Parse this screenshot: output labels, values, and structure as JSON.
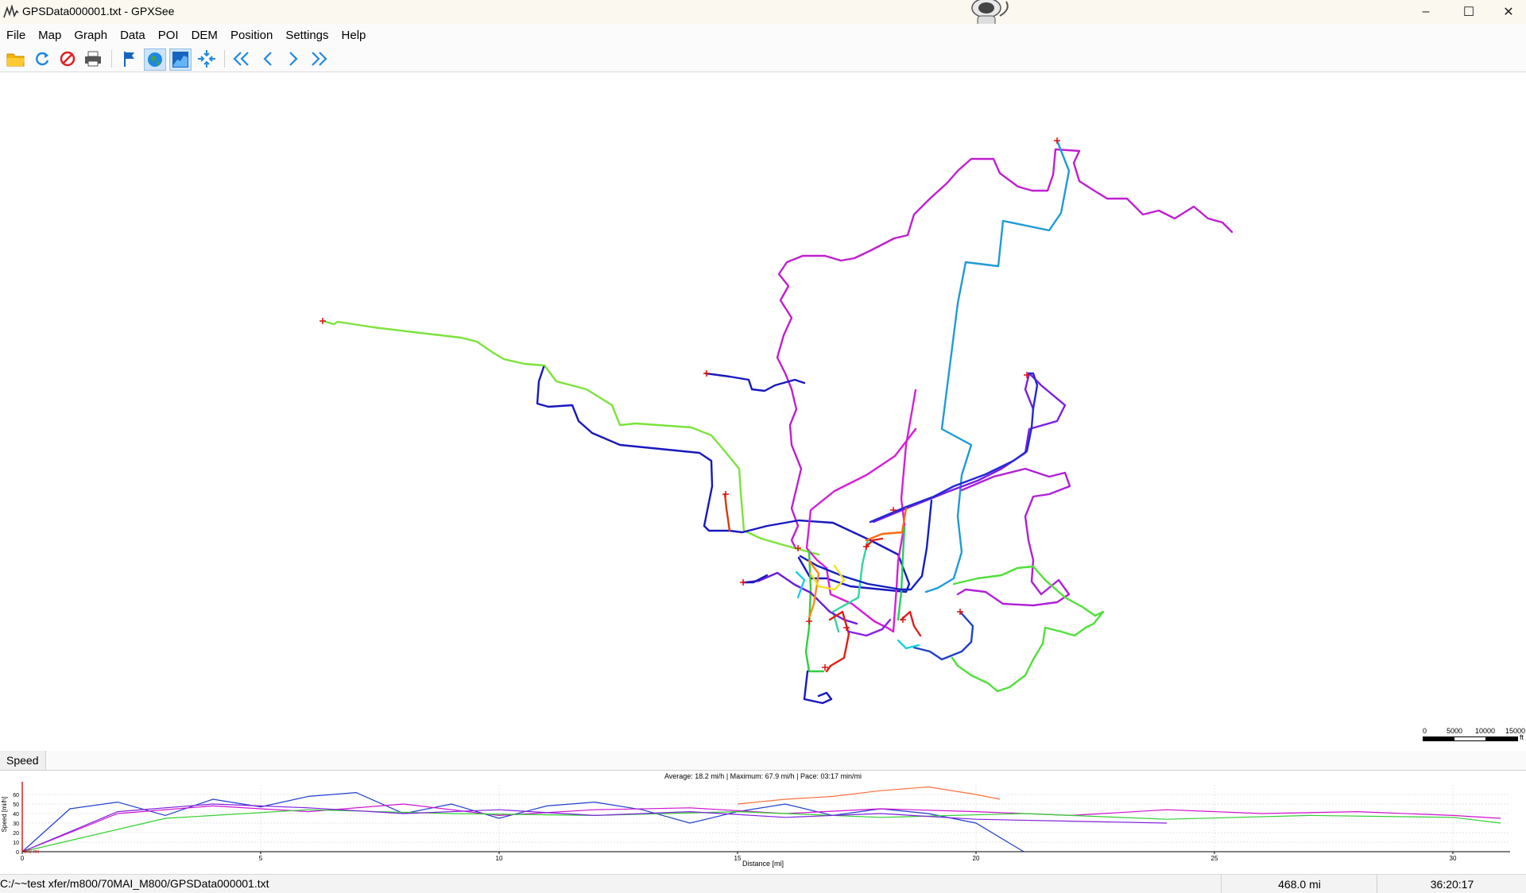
{
  "window": {
    "title": "GPSData000001.txt - GPXSee",
    "minimize_glyph": "–",
    "maximize_glyph": "☐",
    "close_glyph": "✕"
  },
  "menu": [
    "File",
    "Map",
    "Graph",
    "Data",
    "POI",
    "DEM",
    "Position",
    "Settings",
    "Help"
  ],
  "toolbar": {
    "icons": [
      "open-folder-icon",
      "reload-icon",
      "close-file-icon",
      "print-icon",
      "flag-icon",
      "globe-icon",
      "graph-icon",
      "center-map-icon",
      "first-file-icon",
      "previous-file-icon",
      "next-file-icon",
      "last-file-icon"
    ]
  },
  "scale_bar": {
    "labels": [
      "0",
      "5000",
      "10000",
      "15000"
    ],
    "unit": "ft"
  },
  "graph": {
    "tab_label": "Speed",
    "info": "Average: 18.2 mi/h  |  Maximum: 67.9 mi/h  |  Pace: 03:17 min/mi",
    "y_axis_label": "Speed [mi/h]",
    "x_axis_label": "Distance [mi]",
    "marker_label": "0.0 mi"
  },
  "status": {
    "path": "C:/~~test xfer/m800/70MAI_M800/GPSData000001.txt",
    "distance": "468.0 mi",
    "time": "36:20:17"
  },
  "chart_data": {
    "type": "line",
    "title": "",
    "subtitle": "Average: 18.2 mi/h  |  Maximum: 67.9 mi/h  |  Pace: 03:17 min/mi",
    "xlabel": "Distance [mi]",
    "ylabel": "Speed [mi/h]",
    "xlim": [
      0,
      31.2
    ],
    "ylim": [
      0,
      70
    ],
    "x_ticks": [
      0,
      5,
      10,
      15,
      20,
      25,
      30
    ],
    "y_ticks": [
      0,
      10,
      20,
      30,
      40,
      50,
      60
    ],
    "grid": true,
    "series": [
      {
        "color": "#1f3fd0",
        "x": [
          0,
          1,
          2,
          3,
          4,
          5,
          6,
          7,
          8,
          9,
          10,
          11,
          12,
          13,
          14,
          15,
          16,
          17,
          18,
          19,
          20,
          21
        ],
        "values": [
          0,
          45,
          52,
          38,
          55,
          47,
          58,
          62,
          40,
          50,
          35,
          48,
          52,
          44,
          30,
          42,
          50,
          38,
          45,
          40,
          30,
          0
        ]
      },
      {
        "color": "#d010d0",
        "x": [
          0,
          2,
          4,
          6,
          8,
          10,
          12,
          14,
          16,
          18,
          20,
          22,
          24,
          26,
          28,
          30,
          31
        ],
        "values": [
          0,
          40,
          48,
          42,
          50,
          38,
          44,
          46,
          40,
          45,
          42,
          38,
          44,
          40,
          42,
          38,
          35
        ]
      },
      {
        "color": "#30d030",
        "x": [
          0,
          3,
          6,
          9,
          12,
          15,
          18,
          21,
          24,
          27,
          30,
          31
        ],
        "values": [
          0,
          35,
          44,
          40,
          38,
          42,
          36,
          40,
          34,
          38,
          36,
          30
        ]
      },
      {
        "color": "#ff7040",
        "x": [
          15,
          16,
          17,
          18,
          19,
          20,
          20.5
        ],
        "values": [
          50,
          55,
          58,
          64,
          67.9,
          60,
          55
        ]
      },
      {
        "color": "#8020e0",
        "x": [
          0,
          2,
          4,
          6,
          8,
          10,
          12,
          14,
          16,
          18,
          20,
          22,
          24
        ],
        "values": [
          0,
          42,
          50,
          46,
          40,
          44,
          38,
          42,
          36,
          40,
          34,
          32,
          30
        ]
      }
    ]
  }
}
